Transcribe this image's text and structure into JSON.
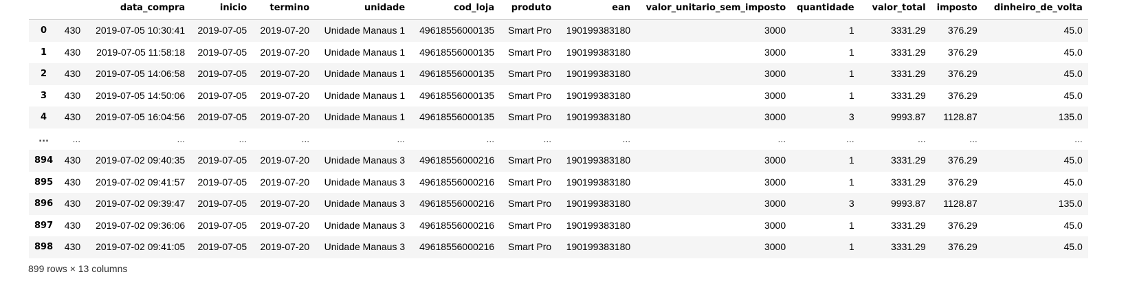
{
  "table": {
    "index_header": "",
    "columns": [
      "",
      "data_compra",
      "inicio",
      "termino",
      "unidade",
      "cod_loja",
      "produto",
      "ean",
      "valor_unitario_sem_imposto",
      "quantidade",
      "valor_total",
      "imposto",
      "dinheiro_de_volta"
    ],
    "rows": [
      {
        "index": "0",
        "cells": [
          "430",
          "2019-07-05 10:30:41",
          "2019-07-05",
          "2019-07-20",
          "Unidade Manaus 1",
          "49618556000135",
          "Smart Pro",
          "190199383180",
          "3000",
          "1",
          "3331.29",
          "376.29",
          "45.0"
        ]
      },
      {
        "index": "1",
        "cells": [
          "430",
          "2019-07-05 11:58:18",
          "2019-07-05",
          "2019-07-20",
          "Unidade Manaus 1",
          "49618556000135",
          "Smart Pro",
          "190199383180",
          "3000",
          "1",
          "3331.29",
          "376.29",
          "45.0"
        ]
      },
      {
        "index": "2",
        "cells": [
          "430",
          "2019-07-05 14:06:58",
          "2019-07-05",
          "2019-07-20",
          "Unidade Manaus 1",
          "49618556000135",
          "Smart Pro",
          "190199383180",
          "3000",
          "1",
          "3331.29",
          "376.29",
          "45.0"
        ]
      },
      {
        "index": "3",
        "cells": [
          "430",
          "2019-07-05 14:50:06",
          "2019-07-05",
          "2019-07-20",
          "Unidade Manaus 1",
          "49618556000135",
          "Smart Pro",
          "190199383180",
          "3000",
          "1",
          "3331.29",
          "376.29",
          "45.0"
        ]
      },
      {
        "index": "4",
        "cells": [
          "430",
          "2019-07-05 16:04:56",
          "2019-07-05",
          "2019-07-20",
          "Unidade Manaus 1",
          "49618556000135",
          "Smart Pro",
          "190199383180",
          "3000",
          "3",
          "9993.87",
          "1128.87",
          "135.0"
        ]
      },
      {
        "index": "...",
        "cells": [
          "...",
          "...",
          "...",
          "...",
          "...",
          "...",
          "...",
          "...",
          "...",
          "...",
          "...",
          "...",
          "..."
        ],
        "ellipsis": true
      },
      {
        "index": "894",
        "cells": [
          "430",
          "2019-07-02 09:40:35",
          "2019-07-05",
          "2019-07-20",
          "Unidade Manaus 3",
          "49618556000216",
          "Smart Pro",
          "190199383180",
          "3000",
          "1",
          "3331.29",
          "376.29",
          "45.0"
        ]
      },
      {
        "index": "895",
        "cells": [
          "430",
          "2019-07-02 09:41:57",
          "2019-07-05",
          "2019-07-20",
          "Unidade Manaus 3",
          "49618556000216",
          "Smart Pro",
          "190199383180",
          "3000",
          "1",
          "3331.29",
          "376.29",
          "45.0"
        ]
      },
      {
        "index": "896",
        "cells": [
          "430",
          "2019-07-02 09:39:47",
          "2019-07-05",
          "2019-07-20",
          "Unidade Manaus 3",
          "49618556000216",
          "Smart Pro",
          "190199383180",
          "3000",
          "3",
          "9993.87",
          "1128.87",
          "135.0"
        ]
      },
      {
        "index": "897",
        "cells": [
          "430",
          "2019-07-02 09:36:06",
          "2019-07-05",
          "2019-07-20",
          "Unidade Manaus 3",
          "49618556000216",
          "Smart Pro",
          "190199383180",
          "3000",
          "1",
          "3331.29",
          "376.29",
          "45.0"
        ]
      },
      {
        "index": "898",
        "cells": [
          "430",
          "2019-07-02 09:41:05",
          "2019-07-05",
          "2019-07-20",
          "Unidade Manaus 3",
          "49618556000216",
          "Smart Pro",
          "190199383180",
          "3000",
          "1",
          "3331.29",
          "376.29",
          "45.0"
        ]
      }
    ]
  },
  "footer": {
    "summary": "899 rows × 13 columns"
  }
}
